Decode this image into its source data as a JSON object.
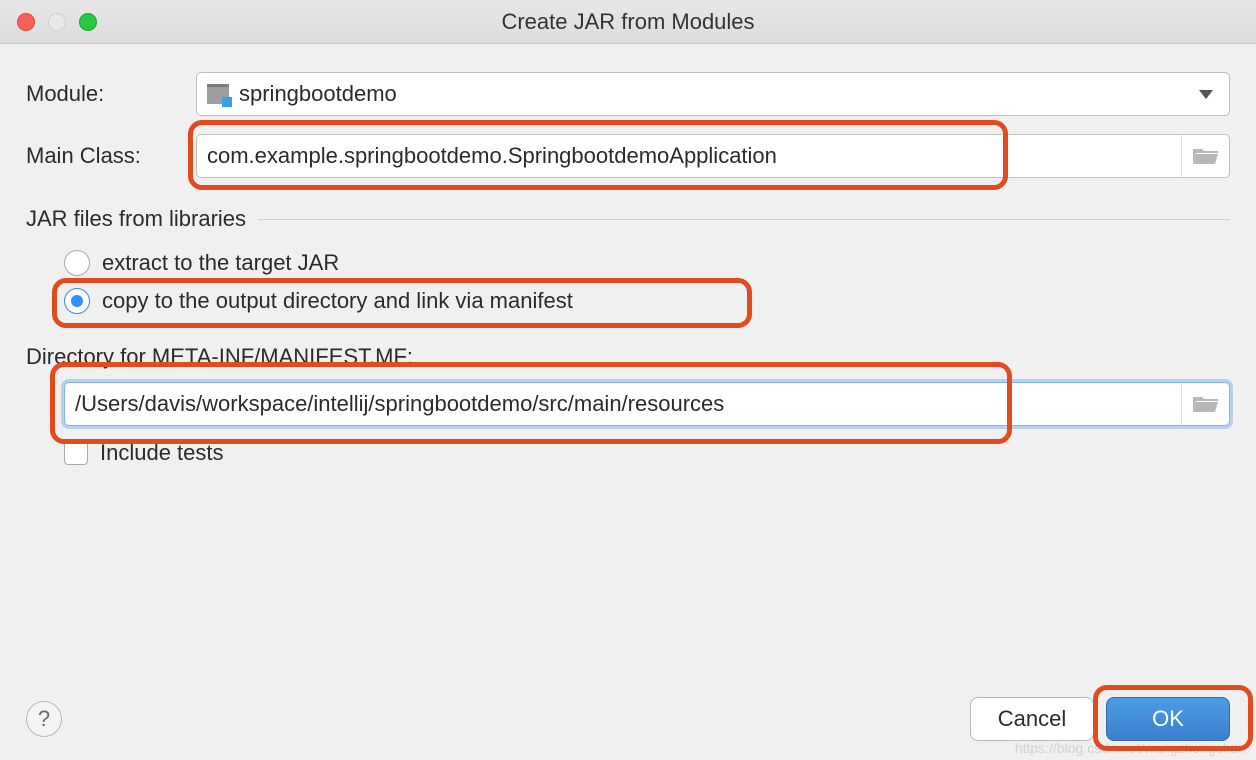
{
  "dialog": {
    "title": "Create JAR from Modules"
  },
  "form": {
    "module_label": "Module:",
    "module_value": "springbootdemo",
    "main_class_label": "Main Class:",
    "main_class_value": "com.example.springbootdemo.SpringbootdemoApplication",
    "libraries_section": "JAR files from libraries",
    "radio_extract": "extract to the target JAR",
    "radio_copy": "copy to the output directory and link via manifest",
    "manifest_dir_label": "Directory for META-INF/MANIFEST.MF:",
    "manifest_dir_value": "/Users/davis/workspace/intellij/springbootdemo/src/main/resources",
    "include_tests_label": "Include tests"
  },
  "buttons": {
    "help": "?",
    "cancel": "Cancel",
    "ok": "OK"
  },
  "watermark": "https://blog.csdn.net/wangzhongchun"
}
